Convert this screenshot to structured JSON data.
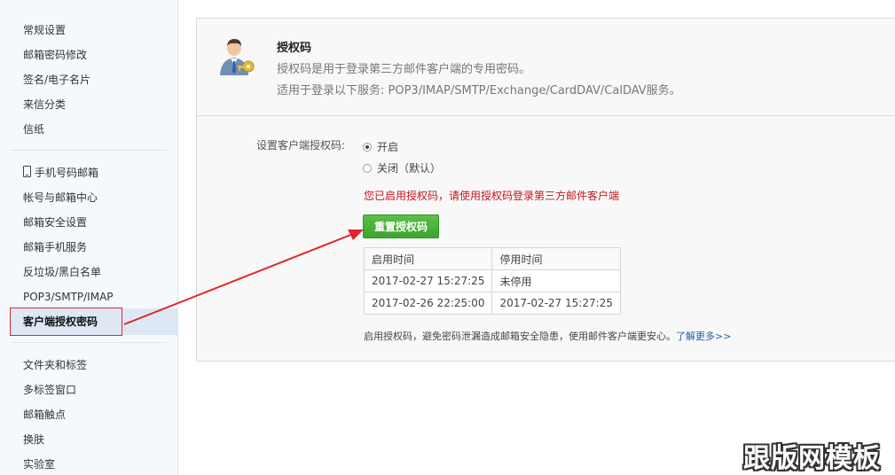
{
  "sidebar": {
    "group1": [
      "常规设置",
      "邮箱密码修改",
      "签名/电子名片",
      "来信分类",
      "信纸"
    ],
    "group2": [
      "手机号码邮箱",
      "帐号与邮箱中心",
      "邮箱安全设置",
      "邮箱手机服务",
      "反垃圾/黑白名单",
      "POP3/SMTP/IMAP",
      "客户端授权密码"
    ],
    "group3": [
      "文件夹和标签",
      "多标签窗口",
      "邮箱触点",
      "换肤",
      "实验室"
    ],
    "active_item": "客户端授权密码"
  },
  "panel": {
    "title": "授权码",
    "desc1": "授权码是用于登录第三方邮件客户端的专用密码。",
    "desc2": "适用于登录以下服务: POP3/IMAP/SMTP/Exchange/CardDAV/CalDAV服务。",
    "setting_label": "设置客户端授权码:",
    "radio_on": "开启",
    "radio_off": "关闭（默认）",
    "selected": "开启",
    "notice": "您已启用授权码，请使用授权码登录第三方邮件客户端",
    "reset_button": "重置授权码",
    "table": {
      "headers": [
        "启用时间",
        "停用时间"
      ],
      "rows": [
        [
          "2017-02-27 15:27:25",
          "未停用"
        ],
        [
          "2017-02-26 22:25:00",
          "2017-02-27 15:27:25"
        ]
      ]
    },
    "footer_text": "启用授权码，避免密码泄漏造成邮箱安全隐患，使用邮件客户端更安心。",
    "footer_link": "了解更多>>"
  },
  "watermark": "跟版网模板",
  "colors": {
    "notice": "#c8161d",
    "button": "#3aa42c",
    "link": "#1f5fa8",
    "annotation": "#e0262a"
  }
}
